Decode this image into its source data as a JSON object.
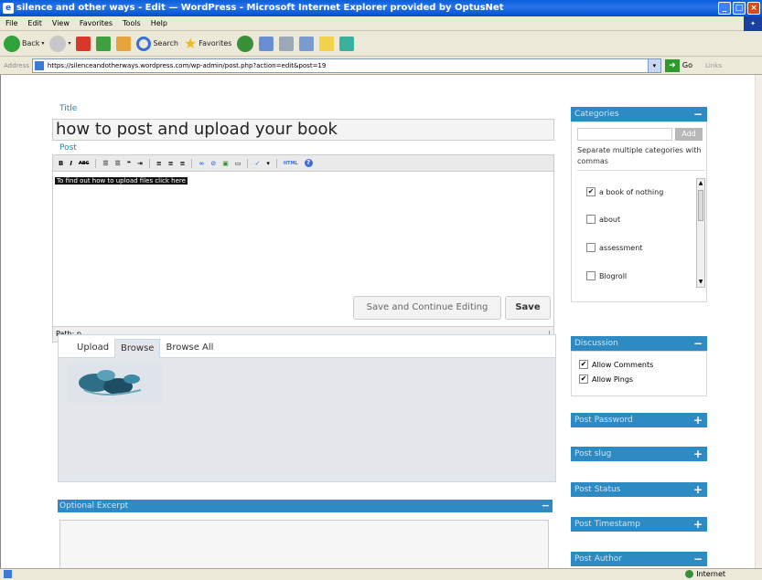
{
  "window": {
    "title": "silence and other ways - Edit — WordPress - Microsoft Internet Explorer provided by OptusNet"
  },
  "menu": [
    "File",
    "Edit",
    "View",
    "Favorites",
    "Tools",
    "Help"
  ],
  "toolbar": {
    "back_label": "Back",
    "search_label": "Search",
    "favorites_label": "Favorites"
  },
  "address": {
    "label": "Address",
    "url": "https://silenceandotherways.wordpress.com/wp-admin/post.php?action=edit&post=19",
    "go_label": "Go",
    "links_label": "Links"
  },
  "editor": {
    "title_label": "Title",
    "title_value": "how to post and upload your book",
    "post_label": "Post",
    "body_text": "To find out how to upload files click here",
    "path_label": "Path: p"
  },
  "buttons": {
    "save_continue": "Save and Continue Editing",
    "save": "Save"
  },
  "upload": {
    "tabs": [
      "Upload",
      "Browse",
      "Browse All"
    ],
    "active_tab": "Browse"
  },
  "excerpt": {
    "label": "Optional Excerpt"
  },
  "sidebar": {
    "categories": {
      "label": "Categories",
      "add_label": "Add",
      "note": "Separate multiple categories with commas",
      "items": [
        {
          "label": "a book of nothing",
          "checked": true
        },
        {
          "label": "about",
          "checked": false
        },
        {
          "label": "assessment",
          "checked": false
        },
        {
          "label": "Blogroll",
          "checked": false
        }
      ]
    },
    "discussion": {
      "label": "Discussion",
      "items": [
        {
          "label": "Allow Comments",
          "checked": true
        },
        {
          "label": "Allow Pings",
          "checked": true
        }
      ]
    },
    "panels": [
      "Post Password",
      "Post slug",
      "Post Status",
      "Post Timestamp",
      "Post Author"
    ]
  },
  "status": {
    "zone": "Internet"
  },
  "colors": {
    "wp_bar": "#2e8ac2",
    "label_blue": "#2583ad",
    "ie_title": "#0a5fd8"
  }
}
